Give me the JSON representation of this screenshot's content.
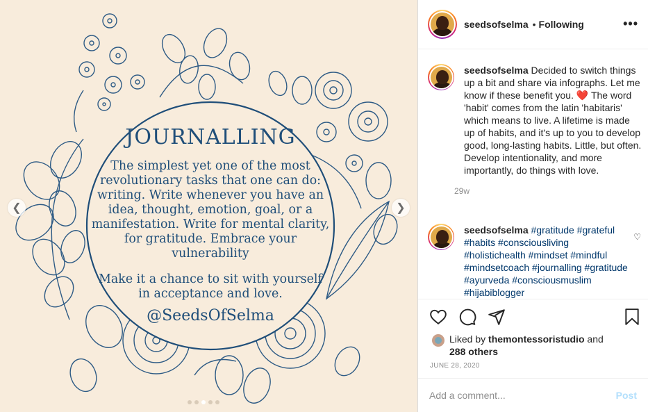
{
  "post_image": {
    "title": "JOURNALLING",
    "body": "The simplest yet one of the most revolutionary tasks that one can do: writing.  Write whenever you have an idea, thought, emotion, goal, or a manifestation. Write for mental clarity, for gratitude. Embrace your vulnerability",
    "body2": "Make it a chance to sit with yourself in acceptance and love.",
    "handle": "@SeedsOfSelma",
    "prev_icon": "chevron-left-icon",
    "next_icon": "chevron-right-icon",
    "background_color": "#f8ecdc",
    "ink_color": "#1f4e79"
  },
  "header": {
    "username": "seedsofselma",
    "separator": "•",
    "follow_status": "Following",
    "more_icon": "more-options-icon"
  },
  "caption": {
    "username": "seedsofselma",
    "text_before_heart": "Decided to switch things up a bit and share via infographs. Let me know if these benefit you. ",
    "heart": "❤️",
    "text_after_heart": " The word 'habit' comes from the latin 'habitaris' which means to live. A lifetime is made up of habits, and it's up to you to develop good, long-lasting habits. Little, but often. Develop intentionality, and more importantly, do things with love.",
    "time": "29w"
  },
  "hashtag_comment": {
    "username": "seedsofselma",
    "tags": "#gratitude #grateful #habits #consciousliving #holistichealth #mindset #mindful #mindsetcoach #journalling #gratitude #ayurveda #consciousmuslim #hijabiblogger"
  },
  "actions": {
    "like_icon": "heart-icon",
    "comment_icon": "comment-icon",
    "share_icon": "share-icon",
    "save_icon": "bookmark-icon"
  },
  "likes": {
    "prefix": "Liked by",
    "user": "themontessoristudio",
    "and": "and",
    "others": "288 others"
  },
  "date": "JUNE 28, 2020",
  "comment_box": {
    "placeholder": "Add a comment...",
    "post_label": "Post"
  }
}
